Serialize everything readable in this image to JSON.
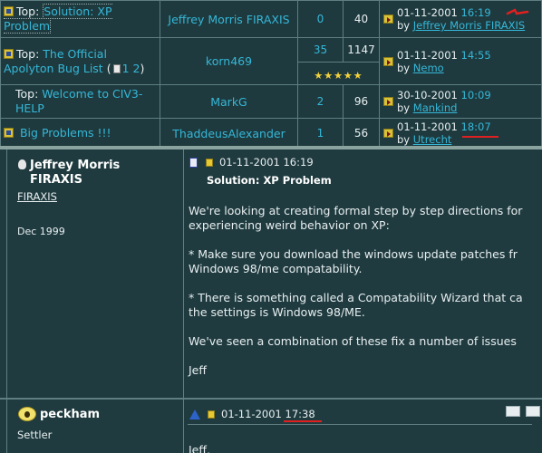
{
  "threads": [
    {
      "prefix": "Top:",
      "title": "Solution: XP Problem",
      "author": "Jeffrey Morris FIRAXIS",
      "replies": "0",
      "views": "40",
      "last_date": "01-11-2001",
      "last_time": "16:19",
      "by_label": "by",
      "last_by": "Jeffrey Morris FIRAXIS"
    },
    {
      "prefix": "Top:",
      "title": "The Official Apolyton Bug List",
      "pages_open": "(",
      "page1": "1",
      "page2": "2",
      "pages_close": ")",
      "author": "korn469",
      "replies": "35",
      "views": "1147",
      "rating": "★★★★★",
      "last_date": "01-11-2001",
      "last_time": "14:55",
      "by_label": "by",
      "last_by": "Nemo"
    },
    {
      "prefix": "Top:",
      "title": "Welcome to CIV3-HELP",
      "author": "MarkG",
      "replies": "2",
      "views": "96",
      "last_date": "30-10-2001",
      "last_time": "10:09",
      "by_label": "by",
      "last_by": "Mankind"
    },
    {
      "title": "Big Problems !!!",
      "author": "ThaddeusAlexander",
      "replies": "1",
      "views": "56",
      "last_date": "01-11-2001",
      "last_time": "18:07",
      "by_label": "by",
      "last_by": "Utrecht"
    }
  ],
  "post1": {
    "author_line1": "Jeffrey Morris",
    "author_line2": "FIRAXIS",
    "user_title": "FIRAXIS",
    "join_date": "Dec 1999",
    "datetime": "01-11-2001 16:19",
    "subject": "Solution: XP Problem",
    "body": "We're looking at creating formal step by step directions for\nexperiencing weird behavior on XP:\n\n* Make sure you download the windows update patches fr\nWindows 98/me compatability.\n\n* There is something called a Compatability Wizard that ca\nthe settings is Windows 98/ME.\n\nWe've seen a combination of these fix a number of issues\n\nJeff"
  },
  "post2": {
    "author": "peckham",
    "rank": "Settler",
    "date": "01-11-2001",
    "time": "17:38",
    "body": "Jeff,"
  },
  "colors": {
    "background": "#1f3b3f",
    "link": "#35b7d8",
    "annotation_red": "#e02020",
    "star": "#f3d23a"
  }
}
